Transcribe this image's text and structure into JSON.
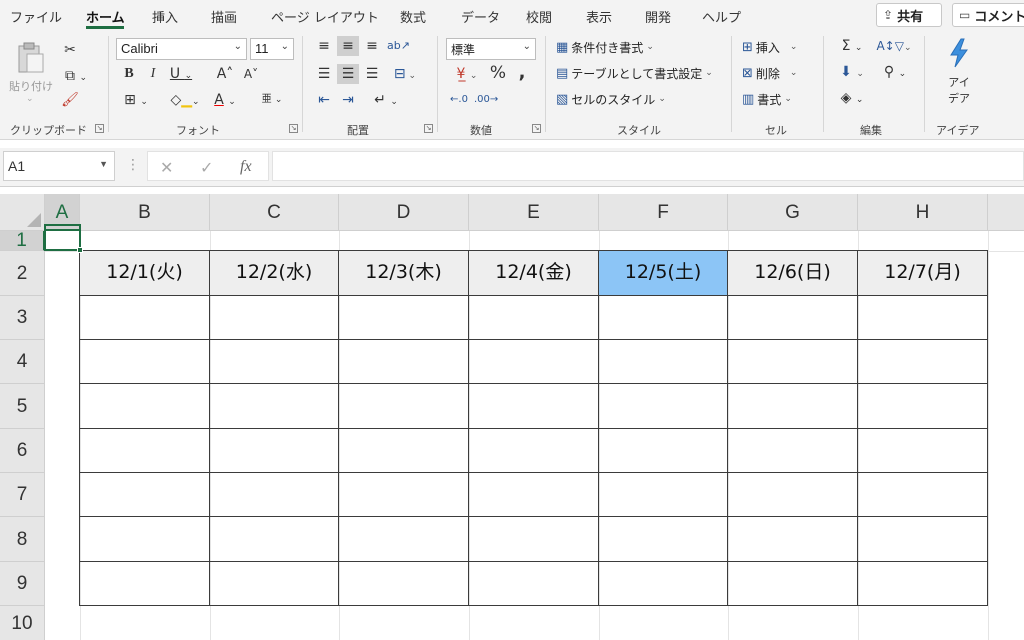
{
  "ribbon_tabs": [
    "ファイル",
    "ホーム",
    "挿入",
    "描画",
    "ページ レイアウト",
    "数式",
    "データ",
    "校閲",
    "表示",
    "開発",
    "ヘルプ"
  ],
  "share_label": "共有",
  "comment_label": "コメント",
  "clipboard": {
    "paste_label": "貼り付け",
    "group": "クリップボード"
  },
  "font": {
    "name": "Calibri",
    "size": "11",
    "group": "フォント"
  },
  "alignment": {
    "group": "配置"
  },
  "number": {
    "format": "標準",
    "group": "数値"
  },
  "styles": {
    "conditional": "条件付き書式",
    "as_table": "テーブルとして書式設定",
    "cell_styles": "セルのスタイル",
    "group": "スタイル"
  },
  "cells": {
    "insert": "挿入",
    "delete": "削除",
    "format": "書式",
    "group": "セル"
  },
  "editing": {
    "group": "編集"
  },
  "ideas": {
    "label1": "アイ",
    "label2": "デア",
    "group": "アイデア"
  },
  "formula_bar": {
    "name_box": "A1",
    "formula": ""
  },
  "columns": [
    "A",
    "B",
    "C",
    "D",
    "E",
    "F",
    "G",
    "H"
  ],
  "rows": [
    "1",
    "2",
    "3",
    "4",
    "5",
    "6",
    "7",
    "8",
    "9",
    "10"
  ],
  "date_headers": [
    "12/1(火)",
    "12/2(水)",
    "12/3(木)",
    "12/4(金)",
    "12/5(土)",
    "12/6(日)",
    "12/7(月)"
  ],
  "highlight_color": "#8cc5f6",
  "accent_color": "#1e6e42"
}
